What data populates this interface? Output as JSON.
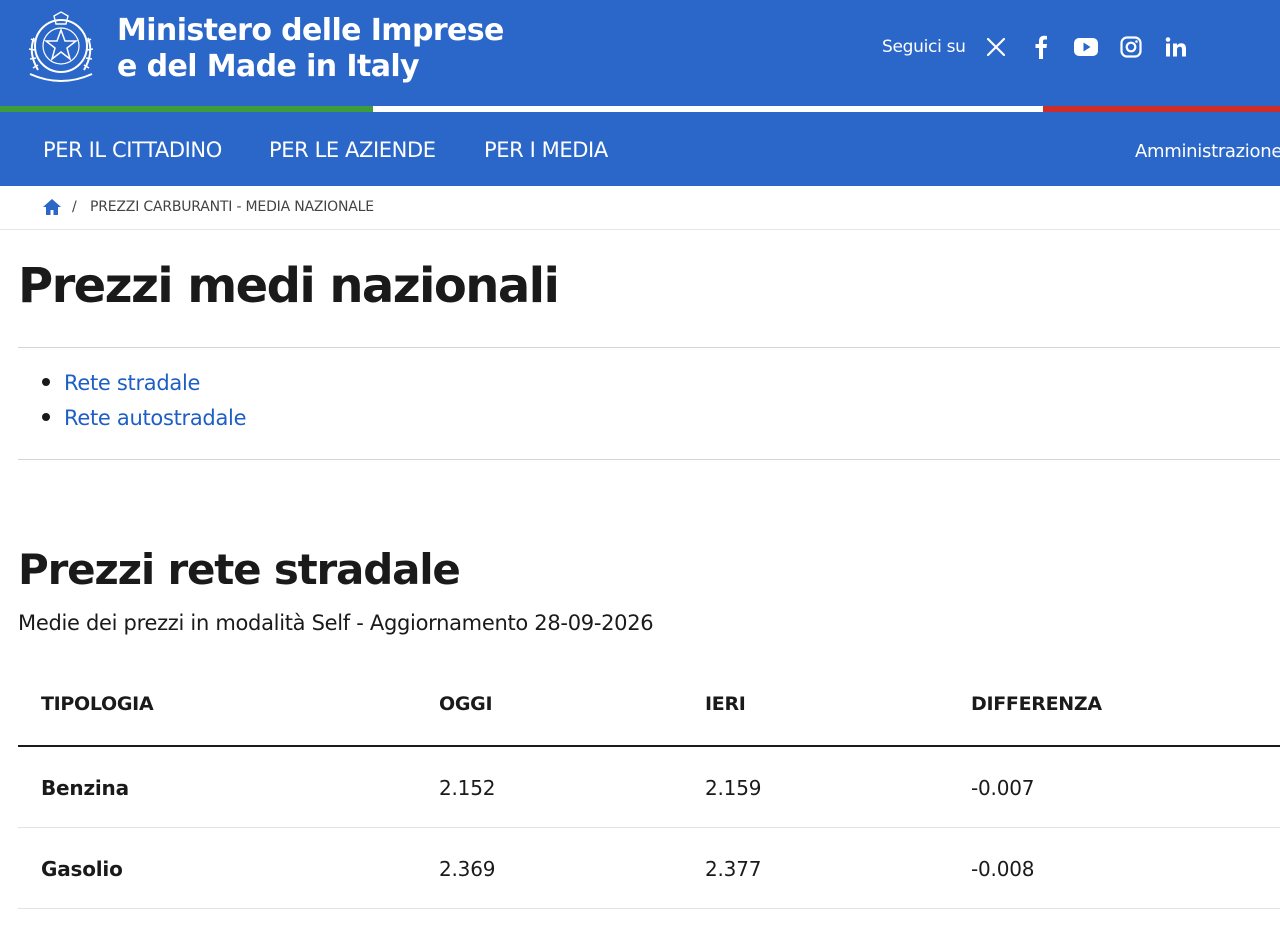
{
  "header": {
    "brand_line1": "Ministero delle Imprese",
    "brand_line2": "e del Made in Italy",
    "follow_label": "Seguici su",
    "social_icons": [
      "x-icon",
      "facebook-icon",
      "youtube-icon",
      "instagram-icon",
      "linkedin-icon"
    ],
    "background_color": "#2a67c9"
  },
  "flag_colors": [
    "#3f9c3a",
    "#ffffff",
    "#cf2c2c"
  ],
  "nav": {
    "items": [
      {
        "label": "PER IL CITTADINO"
      },
      {
        "label": "PER LE AZIENDE"
      },
      {
        "label": "PER I MEDIA"
      }
    ],
    "right_label": "Amministrazione t"
  },
  "breadcrumb": {
    "separator": "/",
    "current": "PREZZI CARBURANTI - MEDIA NAZIONALE"
  },
  "page": {
    "title": "Prezzi medi nazionali",
    "links": [
      {
        "label": "Rete stradale"
      },
      {
        "label": "Rete autostradale"
      }
    ],
    "link_color": "#1d5fc4"
  },
  "section": {
    "title": "Prezzi rete stradale",
    "subtitle": "Medie dei prezzi in modalità Self - Aggiornamento 28-09-2026"
  },
  "table": {
    "headers": [
      "TIPOLOGIA",
      "OGGI",
      "IERI",
      "DIFFERENZA"
    ],
    "rows": [
      {
        "tipologia": "Benzina",
        "oggi": "2.152",
        "ieri": "2.159",
        "differenza": "-0.007"
      },
      {
        "tipologia": "Gasolio",
        "oggi": "2.369",
        "ieri": "2.377",
        "differenza": "-0.008"
      }
    ]
  }
}
